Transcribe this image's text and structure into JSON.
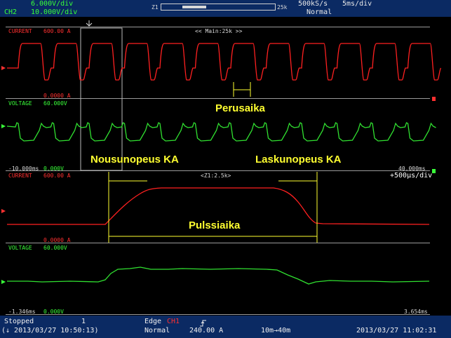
{
  "header": {
    "ch_top_value": "6.000V/div",
    "ch2_label": "CH2",
    "ch2_value": "10.000V/div",
    "zoom_left_label": "Z1",
    "zoom_right_label": "25k",
    "sample_rate": "500kS/s",
    "time_div": "5ms/div",
    "trigger_mode": "Normal"
  },
  "main_view": {
    "center_label": "<< Main:25k >>",
    "current_label": "CURRENT",
    "current_scale_top": "600.00 A",
    "current_scale_bottom": "0.0000 A",
    "voltage_label": "VOLTAGE",
    "voltage_scale_top": "60.000V",
    "voltage_scale_bottom": "0.000V",
    "time_start": "-10.000ms",
    "time_end": "40.000ms"
  },
  "zoom_view": {
    "center_label": "<Z1:2.5k>",
    "time_div": "+500µs/div",
    "current_label": "CURRENT",
    "current_scale_top": "600.00 A",
    "current_scale_bottom": "0.0000 A",
    "voltage_label": "VOLTAGE",
    "voltage_scale_top": "60.000V",
    "voltage_scale_bottom": "0.000V",
    "time_start": "-1.346ms",
    "time_end": "3.654ms"
  },
  "annotations": {
    "perusaika": "Perusaika",
    "nousunopeus": "Nousunopeus KA",
    "laskunopeus": "Laskunopeus KA",
    "pulssiaika": "Pulssiaika"
  },
  "footer": {
    "status": "Stopped",
    "acq_count": "1",
    "start_time": "(↓ 2013/03/27 10:50:13)",
    "trigger_type": "Edge",
    "trigger_source": "CH1",
    "trigger_mode": "Normal",
    "trigger_level": "240.00 A",
    "record_length": "10m→40m",
    "end_time": "2013/03/27 11:02:31"
  },
  "colors": {
    "background": "#000000",
    "header_bar": "#0b2a63",
    "current_trace": "#ff2020",
    "voltage_trace": "#30e030",
    "annotation": "#ffff30",
    "grid": "#9a9a9a"
  },
  "icons": [
    "trigger-position-marker-icon",
    "trigger-edge-icon",
    "channel-marker-icon"
  ]
}
